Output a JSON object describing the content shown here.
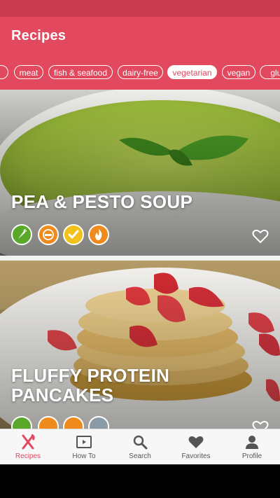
{
  "app": {
    "title": "Recipes"
  },
  "colors": {
    "brand": "#e2485e",
    "status_bar": "#c83a4d",
    "nav_active": "#e2485e",
    "nav_inactive": "#555555"
  },
  "filters": {
    "items": [
      "e",
      "meat",
      "fish & seafood",
      "dairy-free",
      "vegetarian",
      "vegan",
      "glut"
    ],
    "selected": "vegetarian"
  },
  "recipes": [
    {
      "title": "PEA & PESTO SOUP",
      "badges": [
        "vegetarian-carrot-icon",
        "dairy-free-icon",
        "healthy-check-icon",
        "calories-flame-icon"
      ],
      "favorited": false
    },
    {
      "title": "FLUFFY PROTEIN PANCAKES",
      "badges": [
        "vegetarian-carrot-icon",
        "dairy-free-icon",
        "protein-icon",
        "gluten-free-icon"
      ],
      "favorited": false
    }
  ],
  "bottom_nav": {
    "items": [
      {
        "label": "Recipes",
        "icon": "fork-knife-icon",
        "active": true
      },
      {
        "label": "How To",
        "icon": "video-play-icon",
        "active": false
      },
      {
        "label": "Search",
        "icon": "search-icon",
        "active": false
      },
      {
        "label": "Favorites",
        "icon": "heart-icon",
        "active": false
      },
      {
        "label": "Profile",
        "icon": "person-icon",
        "active": false
      }
    ]
  }
}
